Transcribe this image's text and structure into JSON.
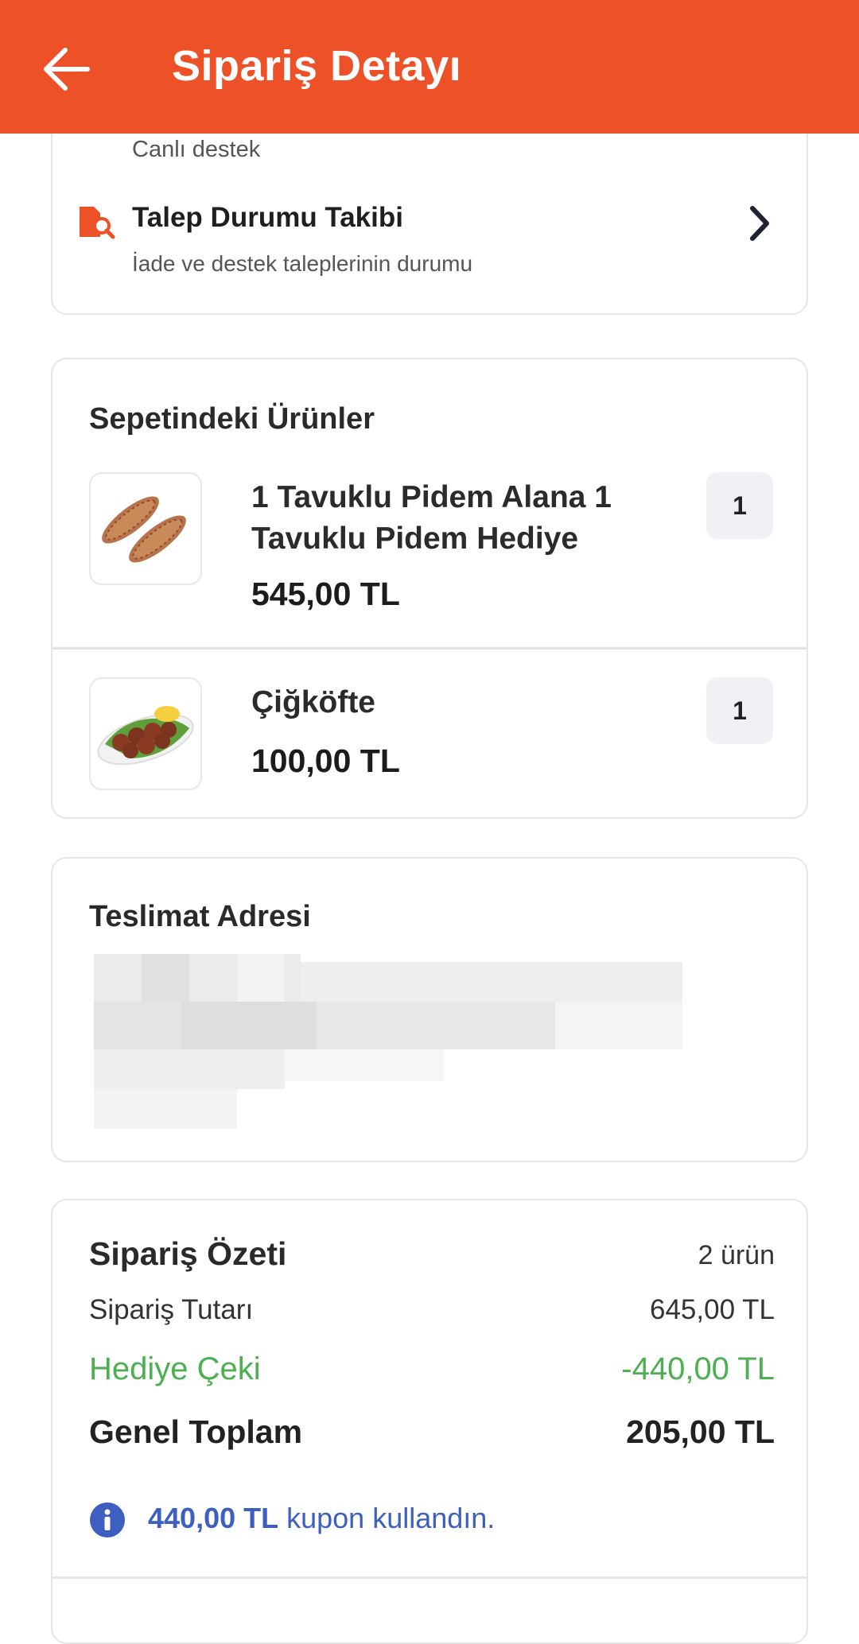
{
  "header": {
    "title": "Sipariş Detayı",
    "back_icon": "arrow-left-icon"
  },
  "support": {
    "live_support_sub": "Canlı destek",
    "request_tracking": {
      "title": "Talep Durumu Takibi",
      "subtitle": "İade ve destek taleplerinin durumu"
    }
  },
  "basket": {
    "title": "Sepetindeki Ürünler",
    "items": [
      {
        "name": "1 Tavuklu Pidem Alana 1 Tavuklu Pidem Hediye",
        "price": "545,00 TL",
        "quantity": "1"
      },
      {
        "name": "Çiğköfte",
        "price": "100,00 TL",
        "quantity": "1"
      }
    ]
  },
  "address": {
    "title": "Teslimat Adresi"
  },
  "summary": {
    "title": "Sipariş Özeti",
    "count": "2 ürün",
    "order_total_label": "Sipariş Tutarı",
    "order_total_value": "645,00 TL",
    "gift_label": "Hediye Çeki",
    "gift_value": "-440,00 TL",
    "grand_total_label": "Genel Toplam",
    "grand_total_value": "205,00 TL",
    "coupon_amount": "440,00 TL",
    "coupon_text": "kupon kullandın."
  },
  "colors": {
    "accent": "#ec5127",
    "gift": "#4caf50",
    "info": "#3d5fbf"
  }
}
